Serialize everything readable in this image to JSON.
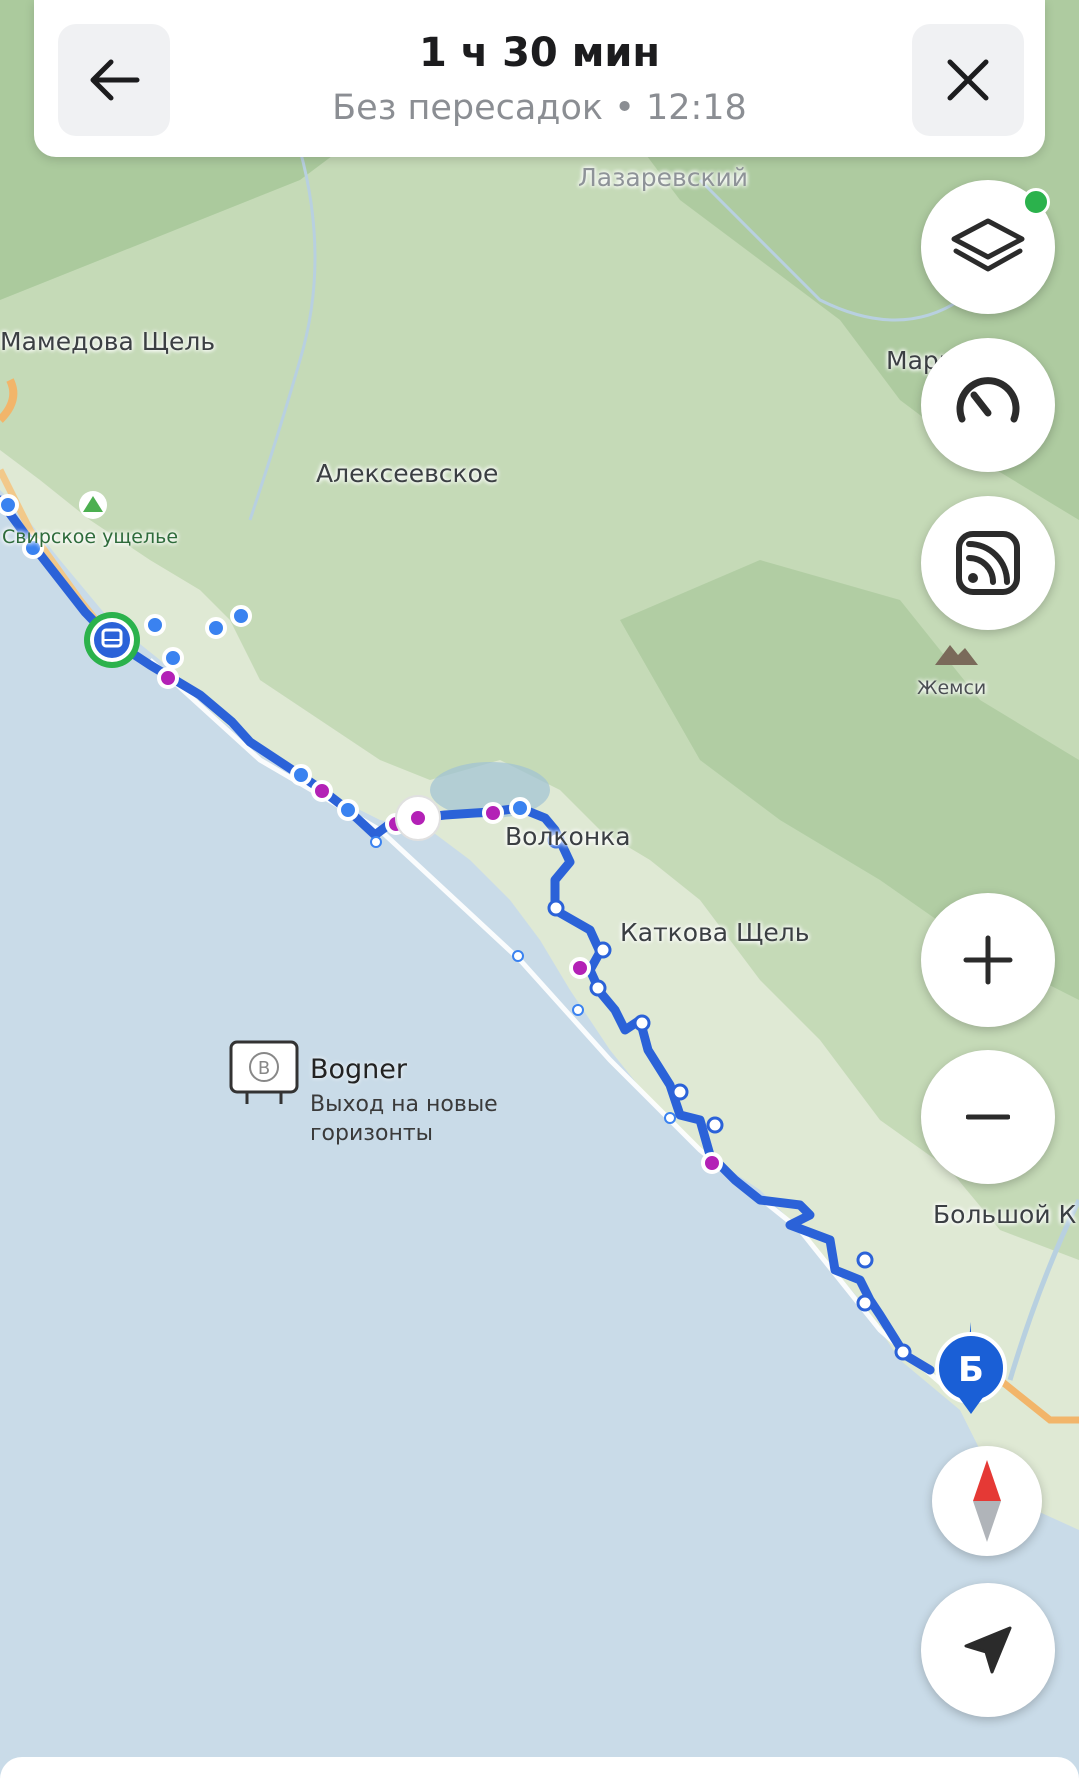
{
  "header": {
    "duration": "1 ч 30 мин",
    "subtitle": "Без пересадок • 12:18"
  },
  "map_labels": {
    "lazarevsky": "Лазаревский",
    "mamedova": "Мамедова Щель",
    "alekseevskoe": "Алексеевское",
    "svirskoe": "Свирское ущелье",
    "zhemsi": "Жемси",
    "volkonka": "Волконка",
    "katkova": "Каткова Щель",
    "marfino": "Марьино",
    "bolshoi": "Большой К"
  },
  "billboard": {
    "title": "Bogner",
    "subtitle": "Выход на новые горизонты"
  },
  "destination_marker": "Б",
  "colors": {
    "route": "#2b62d8",
    "stop_blue": "#3a82f0",
    "stop_magenta": "#b321b6",
    "sea": "#c9dbe8",
    "land": "#dfe9d4",
    "forest": "#a9c79c",
    "accent_green": "#2bb24c"
  }
}
